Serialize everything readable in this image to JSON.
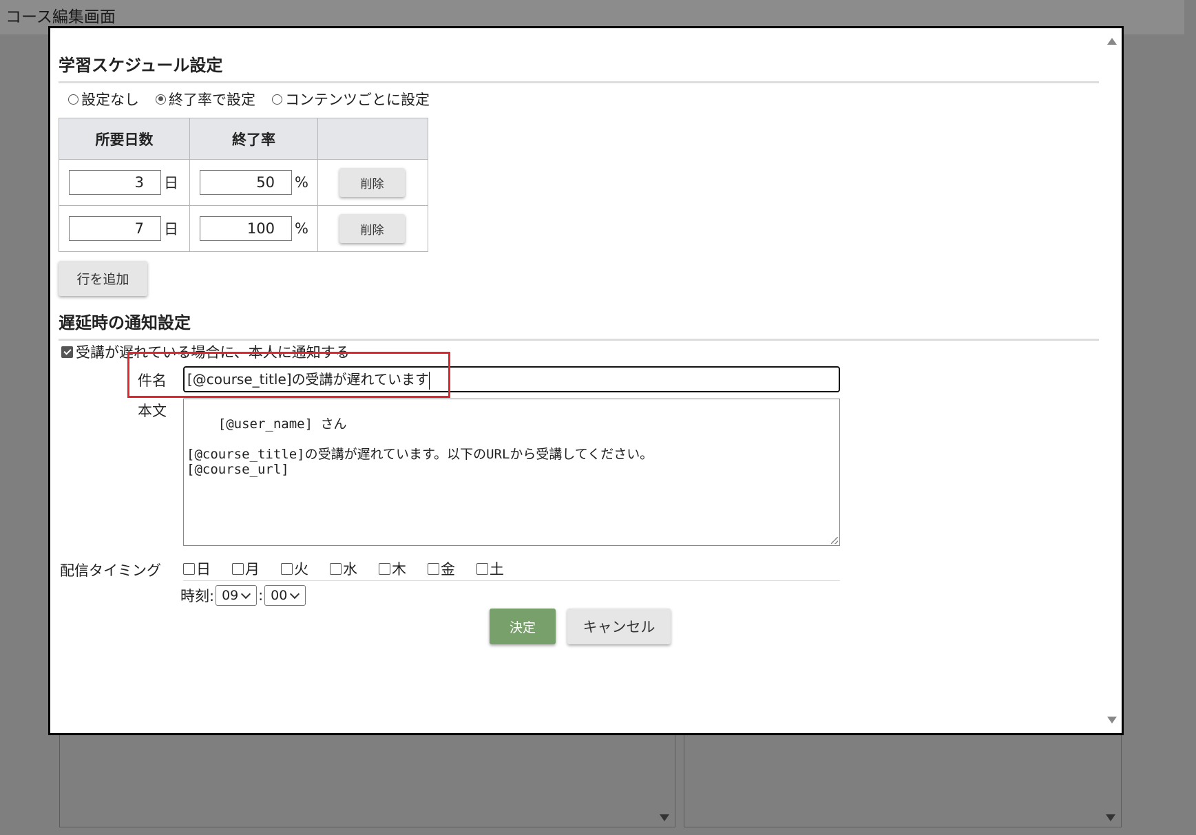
{
  "window": {
    "title": "コース編集画面"
  },
  "schedule": {
    "heading": "学習スケジュール設定",
    "radio_options": [
      {
        "label": "設定なし",
        "checked": false
      },
      {
        "label": "終了率で設定",
        "checked": true
      },
      {
        "label": "コンテンツごとに設定",
        "checked": false
      }
    ],
    "table": {
      "headers": [
        "所要日数",
        "終了率",
        ""
      ],
      "rows": [
        {
          "days": "3",
          "day_unit": "日",
          "rate": "50",
          "rate_unit": "%",
          "delete_label": "削除"
        },
        {
          "days": "7",
          "day_unit": "日",
          "rate": "100",
          "rate_unit": "%",
          "delete_label": "削除"
        }
      ]
    },
    "add_row_label": "行を追加"
  },
  "notification": {
    "heading": "遅延時の通知設定",
    "notify_checkbox": {
      "label": "受講が遅れている場合に、本人に通知する",
      "checked": true
    },
    "subject": {
      "label": "件名",
      "value": "[@course_title]の受講が遅れています"
    },
    "body": {
      "label": "本文",
      "value": "[@user_name] さん\n\n[@course_title]の受講が遅れています。以下のURLから受講してください。\n[@course_url]"
    },
    "timing": {
      "label": "配信タイミング",
      "days": [
        {
          "label": "日",
          "checked": false
        },
        {
          "label": "月",
          "checked": false
        },
        {
          "label": "火",
          "checked": false
        },
        {
          "label": "水",
          "checked": false
        },
        {
          "label": "木",
          "checked": false
        },
        {
          "label": "金",
          "checked": false
        },
        {
          "label": "土",
          "checked": false
        }
      ],
      "time_label": "時刻:",
      "hour": "09",
      "separator": ":",
      "minute": "00"
    }
  },
  "actions": {
    "ok_label": "決定",
    "cancel_label": "キャンセル"
  },
  "colors": {
    "highlight": "#e0262d",
    "ok_button": "#77a06b",
    "overlay": "#7f7f7f"
  }
}
